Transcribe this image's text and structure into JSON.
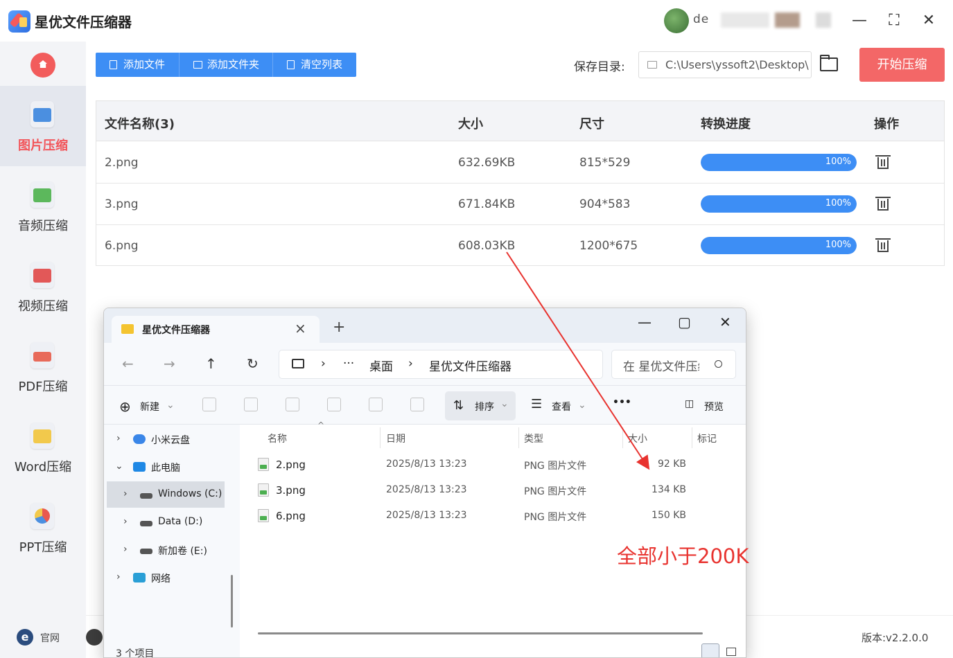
{
  "app": {
    "title": "星优文件压缩器",
    "user_name": "de",
    "window_controls": [
      "minimize-icon",
      "maximize-icon",
      "close-icon"
    ]
  },
  "sidebar": {
    "items": [
      {
        "label": "图片压缩",
        "icon": "image-icon",
        "active": true
      },
      {
        "label": "音频压缩",
        "icon": "audio-icon",
        "active": false
      },
      {
        "label": "视频压缩",
        "icon": "video-icon",
        "active": false
      },
      {
        "label": "PDF压缩",
        "icon": "pdf-icon",
        "active": false
      },
      {
        "label": "Word压缩",
        "icon": "word-icon",
        "active": false
      },
      {
        "label": "PPT压缩",
        "icon": "ppt-icon",
        "active": false
      }
    ],
    "footer_site": "官网"
  },
  "toolbar": {
    "add_file": "添加文件",
    "add_folder": "添加文件夹",
    "clear_list": "清空列表",
    "save_label": "保存目录:",
    "save_path": "C:\\Users\\yssoft2\\Desktop\\",
    "start": "开始压缩"
  },
  "table": {
    "headers": [
      "文件名称(3)",
      "大小",
      "尺寸",
      "转换进度",
      "操作"
    ],
    "rows": [
      {
        "name": "2.png",
        "size": "632.69KB",
        "dim": "815*529",
        "progress": "100%",
        "progress_value": 100
      },
      {
        "name": "3.png",
        "size": "671.84KB",
        "dim": "904*583",
        "progress": "100%",
        "progress_value": 100
      },
      {
        "name": "6.png",
        "size": "608.03KB",
        "dim": "1200*675",
        "progress": "100%",
        "progress_value": 100
      }
    ]
  },
  "version": "版本:v2.2.0.0",
  "explorer": {
    "tab_title": "星优文件压缩器",
    "breadcrumb": [
      "桌面",
      "星优文件压缩器"
    ],
    "search_placeholder": "在 星优文件压缩器 中搜索",
    "commands": {
      "new": "新建",
      "sort": "排序",
      "view": "查看",
      "more": "•••",
      "preview": "预览"
    },
    "tree": [
      {
        "label": "小米云盘",
        "chev": "›",
        "icon": "cloud-icon"
      },
      {
        "label": "此电脑",
        "chev": "⌄",
        "icon": "computer-icon"
      },
      {
        "label": "Windows (C:)",
        "chev": "›",
        "icon": "drive-icon",
        "selected": true
      },
      {
        "label": "Data (D:)",
        "chev": "›",
        "icon": "drive-icon"
      },
      {
        "label": "新加卷 (E:)",
        "chev": "›",
        "icon": "drive-icon"
      },
      {
        "label": "网络",
        "chev": "›",
        "icon": "network-icon"
      }
    ],
    "columns": [
      "名称",
      "日期",
      "类型",
      "大小",
      "标记"
    ],
    "files": [
      {
        "name": "2.png",
        "date": "2025/8/13 13:23",
        "type": "PNG 图片文件",
        "size": "92 KB"
      },
      {
        "name": "3.png",
        "date": "2025/8/13 13:23",
        "type": "PNG 图片文件",
        "size": "134 KB"
      },
      {
        "name": "6.png",
        "date": "2025/8/13 13:23",
        "type": "PNG 图片文件",
        "size": "150 KB"
      }
    ],
    "status": "3 个项目"
  },
  "annotation": {
    "text": "全部小于200K",
    "color": "#e8332f"
  },
  "colors": {
    "accent": "#3d8ef5",
    "start": "#f36767",
    "active_nav": "#f2555a"
  }
}
